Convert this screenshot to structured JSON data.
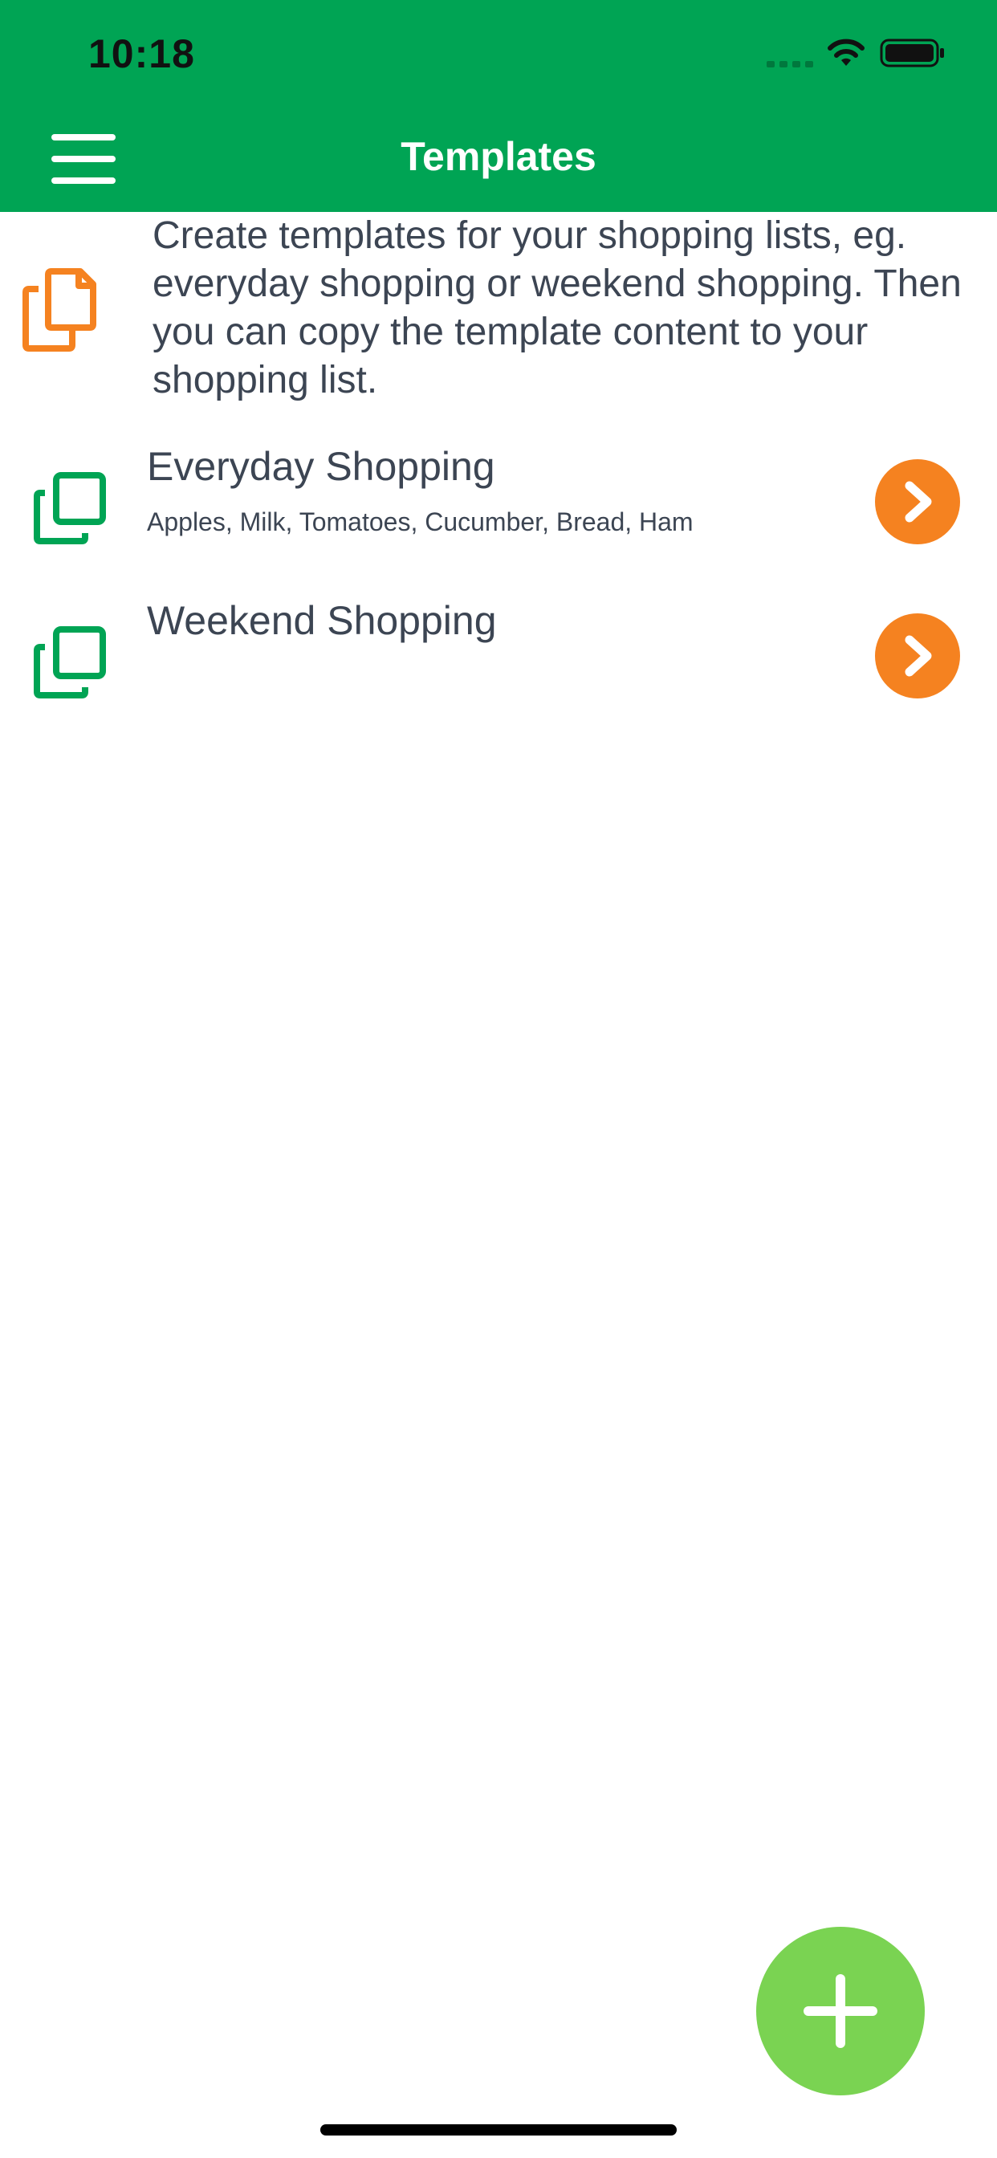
{
  "status_bar": {
    "time": "10:18",
    "icons": [
      "signal-icon",
      "wifi-icon",
      "battery-icon"
    ]
  },
  "header": {
    "title": "Templates",
    "menu_icon": "hamburger-menu-icon",
    "background_color": "#00a454"
  },
  "info": {
    "icon": "copy-document-icon",
    "text": "Create templates for your shopping lists, eg. everyday shopping or weekend shopping. Then you can copy the template content to your shopping list."
  },
  "templates": [
    {
      "name": "Everyday Shopping",
      "items": "Apples, Milk, Tomatoes, Cucumber, Bread, Ham",
      "icon": "template-copy-icon",
      "action_icon": "chevron-right-icon"
    },
    {
      "name": "Weekend Shopping",
      "items": "",
      "icon": "template-copy-icon",
      "action_icon": "chevron-right-icon"
    }
  ],
  "fab": {
    "icon": "plus-icon",
    "color": "#7ad352"
  },
  "colors": {
    "accent_orange": "#f58220",
    "brand_green": "#00a454",
    "text": "#3c4553"
  }
}
